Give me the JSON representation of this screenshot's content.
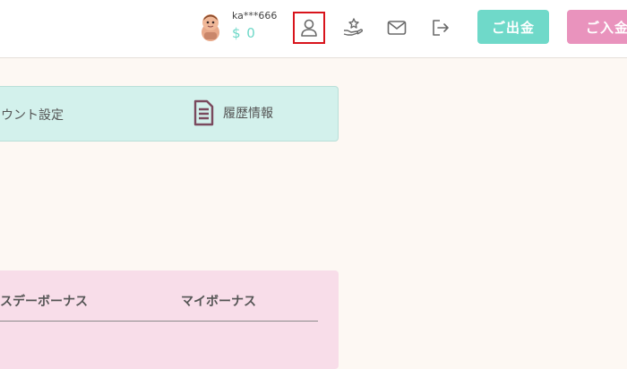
{
  "header": {
    "username": "ka***666",
    "balance": "$ 0",
    "withdraw_label": "ご出金",
    "deposit_label": "ご入金",
    "icons": [
      "profile-icon",
      "bonus-gift-icon",
      "mail-icon",
      "logout-icon"
    ]
  },
  "account_menu": {
    "account_settings_label": "ウント設定",
    "history_label": "履歴情報"
  },
  "bonus_tabs": {
    "birthday_bonus_label": "スデーボーナス",
    "my_bonus_label": "マイボーナス"
  },
  "colors": {
    "accent_teal": "#6fd9c9",
    "accent_pink": "#e993bd",
    "highlight_red": "#d8141c",
    "page_bg": "#fdf8f3"
  }
}
